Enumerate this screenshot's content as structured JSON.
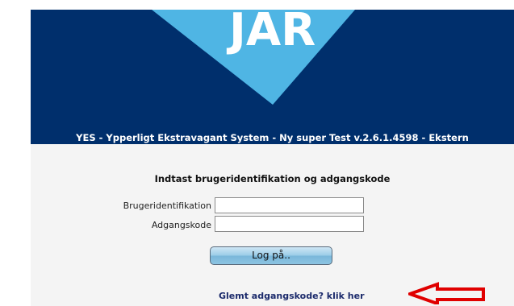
{
  "header": {
    "logo_text": "JAR",
    "system_title": "YES - Ypperligt Ekstravagant System - Ny super Test v.2.6.1.4598 - Ekstern"
  },
  "login": {
    "instructions": "Indtast brugeridentifikation og adgangskode",
    "username_label": "Brugeridentifikation",
    "username_value": "",
    "password_label": "Adgangskode",
    "password_value": "",
    "submit_label": "Log på..",
    "forgot_link": "Glemt adgangskode? klik her"
  },
  "annotation": {
    "arrow_icon": "left-arrow-icon",
    "arrow_color": "#e00000"
  },
  "colors": {
    "header_bg": "#002f6c",
    "logo_panel": "#4fb5e4",
    "panel_bg": "#f4f4f4"
  }
}
